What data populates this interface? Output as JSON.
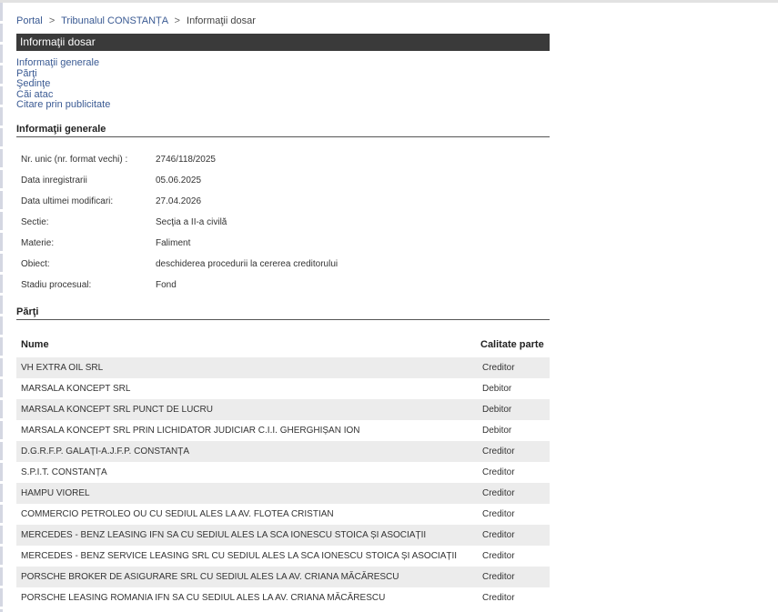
{
  "breadcrumb": {
    "portal": "Portal",
    "sep": ">",
    "court": "Tribunalul CONSTANȚA",
    "current": "Informaţii dosar"
  },
  "title": "Informaţii dosar",
  "nav": [
    {
      "label": "Informaţii generale"
    },
    {
      "label": "Părţi"
    },
    {
      "label": "Şedinţe"
    },
    {
      "label": "Căi atac"
    },
    {
      "label": "Citare prin publicitate"
    }
  ],
  "general": {
    "heading": "Informaţii generale",
    "rows": [
      {
        "label": "Nr. unic (nr. format vechi) :",
        "value": "2746/118/2025"
      },
      {
        "label": "Data inregistrarii",
        "value": "05.06.2025"
      },
      {
        "label": "Data ultimei modificari:",
        "value": "27.04.2026"
      },
      {
        "label": "Sectie:",
        "value": "Secţia a II-a civilă"
      },
      {
        "label": "Materie:",
        "value": "Faliment"
      },
      {
        "label": "Obiect:",
        "value": "deschiderea procedurii la cererea creditorului"
      },
      {
        "label": "Stadiu procesual:",
        "value": "Fond"
      }
    ]
  },
  "parti": {
    "heading": "Părţi",
    "col_name": "Nume",
    "col_calitate": "Calitate parte",
    "rows": [
      {
        "name": "VH EXTRA OIL SRL",
        "calitate": "Creditor"
      },
      {
        "name": "MARSALA KONCEPT SRL",
        "calitate": "Debitor"
      },
      {
        "name": "MARSALA KONCEPT SRL PUNCT DE LUCRU",
        "calitate": "Debitor"
      },
      {
        "name": "MARSALA KONCEPT SRL PRIN LICHIDATOR JUDICIAR C.I.I. GHERGHIȘAN ION",
        "calitate": "Debitor"
      },
      {
        "name": "D.G.R.F.P. GALAȚI-A.J.F.P. CONSTANȚA",
        "calitate": "Creditor"
      },
      {
        "name": "S.P.I.T. CONSTANȚA",
        "calitate": "Creditor"
      },
      {
        "name": "HAMPU VIOREL",
        "calitate": "Creditor"
      },
      {
        "name": "COMMERCIO PETROLEO OU CU SEDIUL ALES LA AV. FLOTEA CRISTIAN",
        "calitate": "Creditor"
      },
      {
        "name": "MERCEDES - BENZ LEASING IFN SA CU SEDIUL ALES LA SCA IONESCU STOICA ȘI ASOCIAȚII",
        "calitate": "Creditor"
      },
      {
        "name": "MERCEDES - BENZ SERVICE LEASING SRL CU SEDIUL ALES LA SCA IONESCU STOICA ȘI ASOCIAȚII",
        "calitate": "Creditor"
      },
      {
        "name": "PORSCHE BROKER DE ASIGURARE SRL CU SEDIUL ALES LA AV. CRIANA MĂCĂRESCU",
        "calitate": "Creditor"
      },
      {
        "name": "PORSCHE LEASING ROMANIA IFN SA CU SEDIUL ALES LA AV. CRIANA MĂCĂRESCU",
        "calitate": "Creditor"
      }
    ]
  }
}
